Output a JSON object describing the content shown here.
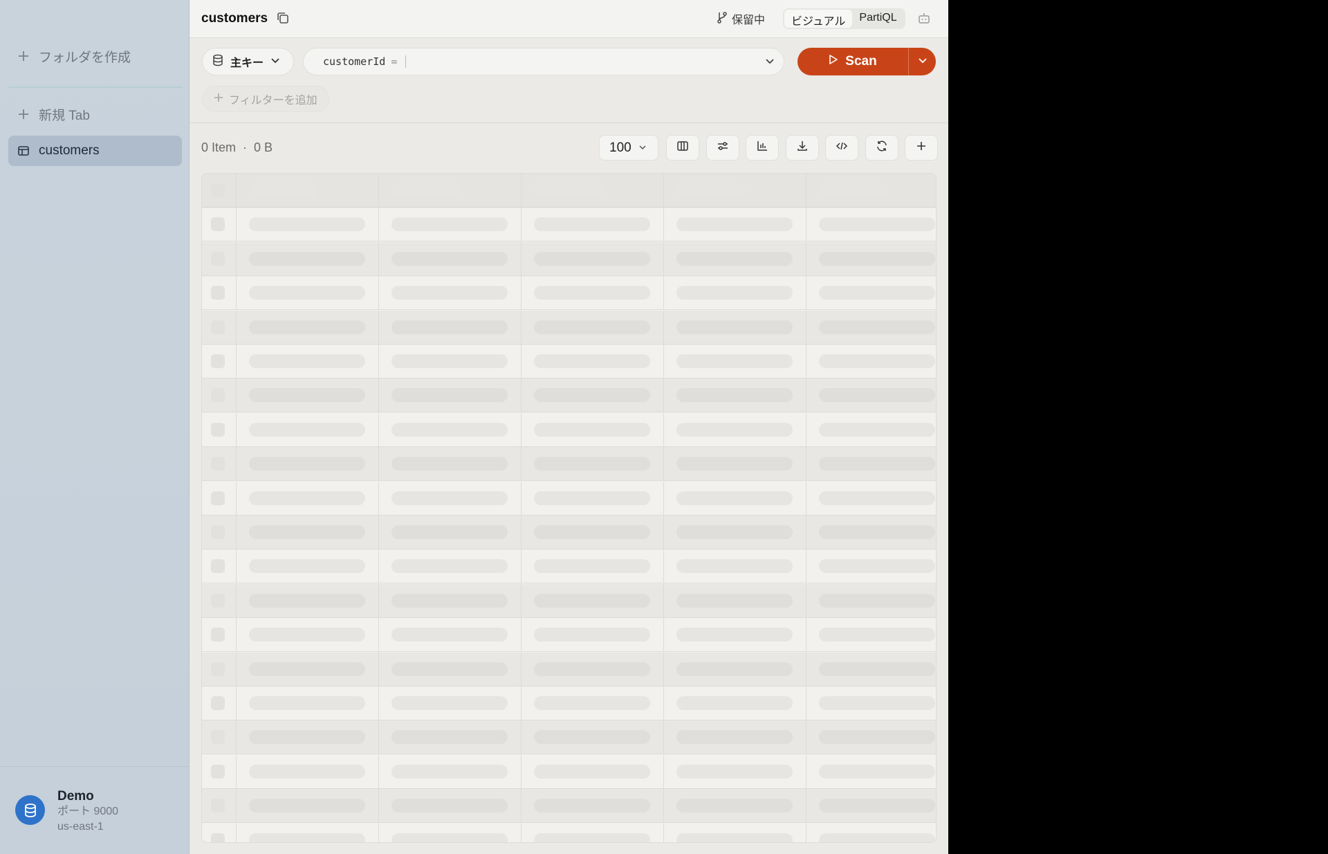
{
  "sidebar": {
    "create_folder": "フォルダを作成",
    "new_tab": "新規 Tab",
    "items": [
      {
        "label": "customers",
        "icon": "table-icon",
        "active": true
      }
    ],
    "connection": {
      "name": "Demo",
      "port": "ポート 9000",
      "region": "us-east-1",
      "icon": "database-icon"
    }
  },
  "header": {
    "title": "customers",
    "pending": "保留中",
    "modes": [
      "ビジュアル",
      "PartiQL"
    ],
    "active_mode": "ビジュアル"
  },
  "query": {
    "index_select": "主キー",
    "key_name": "customerId",
    "operator": "=",
    "key_value": "",
    "scan_label": "Scan",
    "add_filter": "フィルターを追加"
  },
  "results": {
    "item_count": "0 Item",
    "size": "0 B",
    "separator": "·",
    "limit": "100"
  },
  "colors": {
    "accent": "#c84418",
    "sidebar_bg": "#c9d3dc",
    "avatar": "#2e73c9"
  }
}
